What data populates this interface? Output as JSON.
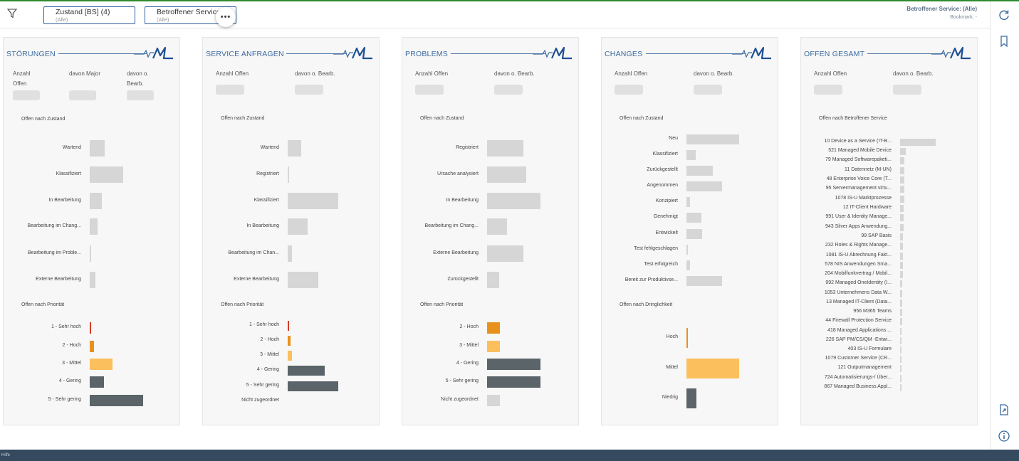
{
  "filterbar": {
    "chip1_title": "Zustand [BS] (4)",
    "chip1_sub": "(Alle)",
    "chip2_title": "Betroffener Service",
    "chip2_sub": "(Alle)",
    "more": "•••",
    "info_service": "Betroffener Service: (Alle)",
    "info_bookmark": "Bookmark: -"
  },
  "bottombar": {
    "label": "Hilfe"
  },
  "colors": {
    "grey_bar": "#d6d6d6",
    "dark_bar": "#5b6468",
    "orange": "#e8921c",
    "light_orange": "#fbbf5e",
    "red": "#d43a2a",
    "accent": "#3b6aa0"
  },
  "icons": [
    "filter-icon",
    "refresh-icon",
    "bookmark-icon",
    "export-icon",
    "info-icon",
    "logo-icon"
  ],
  "cards": [
    {
      "title": "STÖRUNGEN",
      "kpis": [
        "Anzahl Offen",
        "davon Major",
        "davon o. Bearb."
      ],
      "sections": [
        {
          "title": "Offen nach Zustand",
          "rows": [
            {
              "label": "Wartend",
              "value": 0.28,
              "color": "grey"
            },
            {
              "label": "Klassifiziert",
              "value": 0.62,
              "color": "grey"
            },
            {
              "label": "In Bearbeitung",
              "value": 0.22,
              "color": "grey"
            },
            {
              "label": "Bearbeitung im Chang...",
              "value": 0.14,
              "color": "grey"
            },
            {
              "label": "Bearbeitung im Proble...",
              "value": 0.02,
              "color": "grey"
            },
            {
              "label": "Externe Bearbeitung",
              "value": 0.1,
              "color": "grey"
            }
          ]
        },
        {
          "title": "Offen nach Priorität",
          "rows": [
            {
              "label": "1 - Sehr hoch",
              "value": 0.03,
              "color": "red"
            },
            {
              "label": "2 - Hoch",
              "value": 0.08,
              "color": "orange"
            },
            {
              "label": "3 - Mittel",
              "value": 0.43,
              "color": "lightorange"
            },
            {
              "label": "4 - Gering",
              "value": 0.26,
              "color": "dark"
            },
            {
              "label": "5 - Sehr gering",
              "value": 1.0,
              "color": "dark"
            }
          ]
        }
      ]
    },
    {
      "title": "SERVICE ANFRAGEN",
      "kpis": [
        "Anzahl Offen",
        "davon o. Bearb."
      ],
      "sections": [
        {
          "title": "Offen nach Zustand",
          "rows": [
            {
              "label": "Wartend",
              "value": 0.27,
              "color": "grey"
            },
            {
              "label": "Registriert",
              "value": 0.02,
              "color": "grey"
            },
            {
              "label": "Klassifiziert",
              "value": 1.0,
              "color": "grey"
            },
            {
              "label": "In Bearbeitung",
              "value": 0.4,
              "color": "grey"
            },
            {
              "label": "Bearbeitung im Chan...",
              "value": 0.08,
              "color": "grey"
            },
            {
              "label": "Externe Bearbeitung",
              "value": 0.6,
              "color": "grey"
            }
          ]
        },
        {
          "title": "Offen nach Priorität",
          "rows": [
            {
              "label": "1 - Sehr hoch",
              "value": 0.02,
              "color": "red"
            },
            {
              "label": "2 - Hoch",
              "value": 0.06,
              "color": "orange"
            },
            {
              "label": "3 - Mittel",
              "value": 0.09,
              "color": "lightorange"
            },
            {
              "label": "4 - Gering",
              "value": 0.73,
              "color": "dark"
            },
            {
              "label": "5 - Sehr gering",
              "value": 1.0,
              "color": "dark"
            },
            {
              "label": "Nicht zugeordnet",
              "value": 0,
              "color": "grey"
            }
          ]
        }
      ]
    },
    {
      "title": "PROBLEMS",
      "kpis": [
        "Anzahl Offen",
        "davon o. Bearb."
      ],
      "sections": [
        {
          "title": "Offen nach Zustand",
          "rows": [
            {
              "label": "Registriert",
              "value": 0.68,
              "color": "grey"
            },
            {
              "label": "Ursache analysiert",
              "value": 0.73,
              "color": "grey"
            },
            {
              "label": "In Bearbeitung",
              "value": 1.0,
              "color": "grey"
            },
            {
              "label": "Bearbeitung im Chang...",
              "value": 0.37,
              "color": "grey"
            },
            {
              "label": "Externe Bearbeitung",
              "value": 0.68,
              "color": "grey"
            },
            {
              "label": "Zurückgestellt",
              "value": 0.22,
              "color": "grey"
            }
          ]
        },
        {
          "title": "Offen nach Priorität",
          "rows": [
            {
              "label": "2 - Hoch",
              "value": 0.24,
              "color": "orange"
            },
            {
              "label": "3 - Mittel",
              "value": 0.24,
              "color": "lightorange"
            },
            {
              "label": "4 - Gering",
              "value": 1.0,
              "color": "dark"
            },
            {
              "label": "5 - Sehr gering",
              "value": 1.0,
              "color": "dark"
            },
            {
              "label": "Nicht zugeordnet",
              "value": 0.24,
              "color": "grey"
            }
          ]
        }
      ]
    },
    {
      "title": "CHANGES",
      "kpis": [
        "Anzahl Offen",
        "davon o. Bearb."
      ],
      "sections": [
        {
          "title": "Offen nach Zustand",
          "rows": [
            {
              "label": "Neu",
              "value": 1.0,
              "color": "grey"
            },
            {
              "label": "Klassifiziert",
              "value": 0.18,
              "color": "grey"
            },
            {
              "label": "Zurückgestellt",
              "value": 0.5,
              "color": "grey"
            },
            {
              "label": "Angenommen",
              "value": 0.68,
              "color": "grey"
            },
            {
              "label": "Konzipiert",
              "value": 0.07,
              "color": "grey"
            },
            {
              "label": "Genehmigt",
              "value": 0.28,
              "color": "grey"
            },
            {
              "label": "Entwickelt",
              "value": 0.3,
              "color": "grey"
            },
            {
              "label": "Test fehlgeschlagen",
              "value": 0.03,
              "color": "grey"
            },
            {
              "label": "Test erfolgreich",
              "value": 0.07,
              "color": "grey"
            },
            {
              "label": "Bereit zur Produktivse...",
              "value": 0.68,
              "color": "grey"
            }
          ]
        },
        {
          "title": "Offen nach Dringlichkeit",
          "rows": [
            {
              "label": "Hoch",
              "value": 0.03,
              "color": "orange"
            },
            {
              "label": "Mittel",
              "value": 1.0,
              "color": "lightorange"
            },
            {
              "label": "Niedrig",
              "value": 0.19,
              "color": "dark"
            }
          ]
        }
      ]
    },
    {
      "title": "OFFEN GESAMT",
      "kpis": [
        "Anzahl Offen",
        "davon o. Bearb."
      ],
      "sections": [
        {
          "title": "Offen nach Betroffener Service",
          "rows": [
            {
              "label": "10 Device as a Service (IT-B...",
              "value": 1.0,
              "color": "grey"
            },
            {
              "label": "521 Managed Mobile Device",
              "value": 0.16,
              "color": "grey"
            },
            {
              "label": "79 Managed Softwarepaketi...",
              "value": 0.12,
              "color": "grey"
            },
            {
              "label": "11 Datennetz (M-UN)",
              "value": 0.12,
              "color": "grey"
            },
            {
              "label": "48 Enterprise Voice Core (T...",
              "value": 0.12,
              "color": "grey"
            },
            {
              "label": "95 Servermanagement virtu...",
              "value": 0.12,
              "color": "grey"
            },
            {
              "label": "1078 IS-U Marktprozesse",
              "value": 0.12,
              "color": "grey"
            },
            {
              "label": "12 IT-Client Hardware",
              "value": 0.1,
              "color": "grey"
            },
            {
              "label": "991 User & Identity Manage...",
              "value": 0.1,
              "color": "grey"
            },
            {
              "label": "943 Silver Apps Anwendung...",
              "value": 0.1,
              "color": "grey"
            },
            {
              "label": "99 SAP Basis",
              "value": 0.08,
              "color": "grey"
            },
            {
              "label": "232 Roles & Rights Manage...",
              "value": 0.08,
              "color": "grey"
            },
            {
              "label": "1081 IS-U Abrechnung Fakt...",
              "value": 0.07,
              "color": "grey"
            },
            {
              "label": "578 NIS Anwendungen Sma...",
              "value": 0.07,
              "color": "grey"
            },
            {
              "label": "204 Mobilfunkvertrag / Mobil...",
              "value": 0.07,
              "color": "grey"
            },
            {
              "label": "992 Managed OneIdentity (I...",
              "value": 0.06,
              "color": "grey"
            },
            {
              "label": "1053 Unternehmens Data W...",
              "value": 0.06,
              "color": "grey"
            },
            {
              "label": "13 Managed IT-Client (Data...",
              "value": 0.05,
              "color": "grey"
            },
            {
              "label": "956 M365 Teams",
              "value": 0.05,
              "color": "grey"
            },
            {
              "label": "44 Firewall Protection Service",
              "value": 0.05,
              "color": "grey"
            },
            {
              "label": "418 Managed Applications ...",
              "value": 0.04,
              "color": "grey"
            },
            {
              "label": "226 SAP PM/CS/QM -Entwi...",
              "value": 0.04,
              "color": "grey"
            },
            {
              "label": "403 IS-U Formulare",
              "value": 0.04,
              "color": "grey"
            },
            {
              "label": "1079 Customer Service (CR...",
              "value": 0.03,
              "color": "grey"
            },
            {
              "label": "121 Outputmanagement",
              "value": 0.03,
              "color": "grey"
            },
            {
              "label": "724 Automatisierungs-/ Über...",
              "value": 0.03,
              "color": "grey"
            },
            {
              "label": "867 Managed Business Appl...",
              "value": 0.02,
              "color": "grey"
            }
          ]
        }
      ]
    }
  ]
}
